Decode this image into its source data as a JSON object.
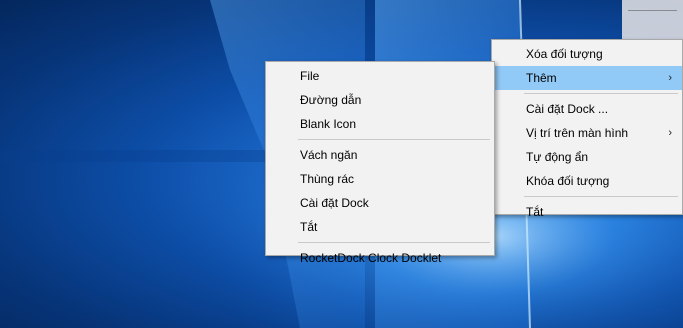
{
  "main_menu": {
    "items": [
      {
        "label": "Xóa đối tượng"
      },
      {
        "label": "Thêm",
        "submenu_arrow": "›"
      },
      {
        "label": "Cài đặt Dock ..."
      },
      {
        "label": "Vị trí trên màn hình",
        "submenu_arrow": "›"
      },
      {
        "label": "Tự động ẩn"
      },
      {
        "label": "Khóa đối tượng"
      },
      {
        "label": "Tắt"
      }
    ]
  },
  "sub_menu": {
    "items": [
      {
        "label": "File"
      },
      {
        "label": "Đường dẫn"
      },
      {
        "label": "Blank Icon"
      },
      {
        "label": "Vách ngăn"
      },
      {
        "label": "Thùng rác"
      },
      {
        "label": "Cài đặt Dock"
      },
      {
        "label": "Tắt"
      },
      {
        "label": "RocketDock Clock Docklet"
      }
    ]
  },
  "colors": {
    "menu_bg": "#f2f2f2",
    "highlight": "#91c9f7",
    "desktop_blue": "#0d4ea8"
  }
}
